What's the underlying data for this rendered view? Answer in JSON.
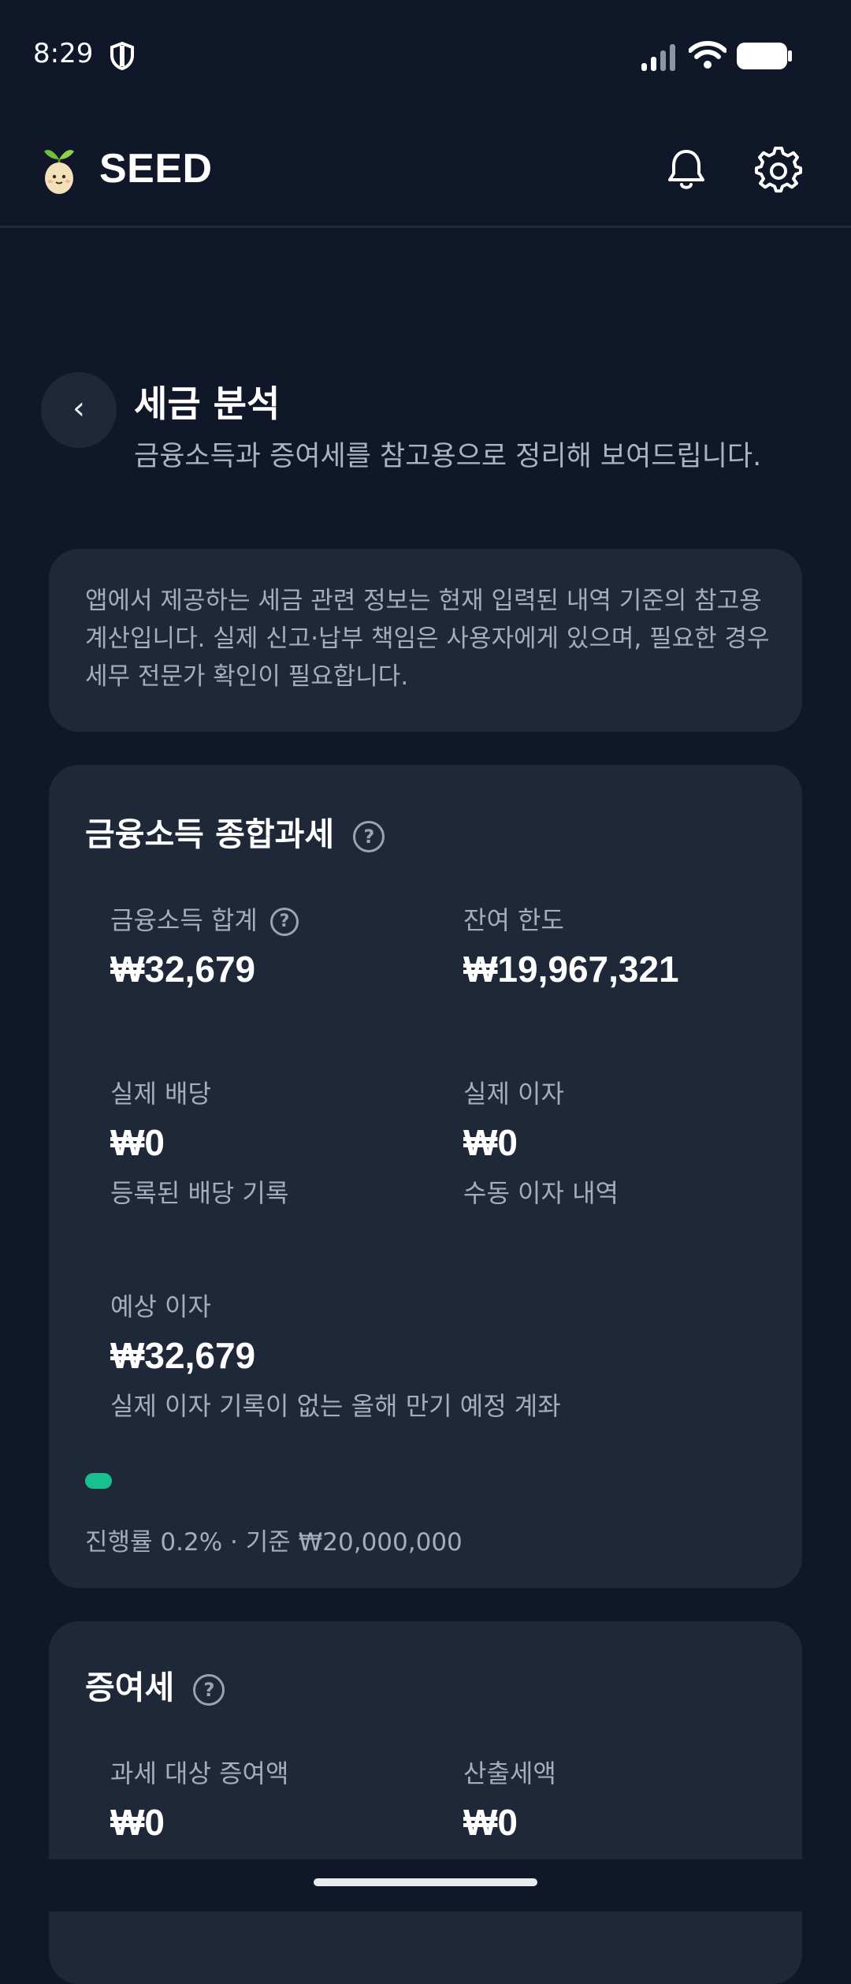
{
  "status_bar": {
    "time": "8:29"
  },
  "app_bar": {
    "brand": "SEED",
    "logo_icon": "seed-sprout-mascot",
    "notification_icon": "bell-icon",
    "settings_icon": "gear-icon"
  },
  "header": {
    "back_label": "‹",
    "title": "세금 분석",
    "subtitle": "금융소득과 증여세를 참고용으로 정리해 보여드립니다."
  },
  "notice": {
    "text": "앱에서 제공하는 세금 관련 정보는 현재 입력된 내역 기준의 참고용 계산입니다. 실제 신고·납부 책임은 사용자에게 있으며, 필요한 경우 세무 전문가 확인이 필요합니다."
  },
  "financial_income": {
    "title": "금융소득 종합과세",
    "total": {
      "label": "금융소득 합계",
      "value": "₩32,679"
    },
    "remaining": {
      "label": "잔여 한도",
      "value": "₩19,967,321"
    },
    "dividend": {
      "label": "실제 배당",
      "value": "₩0",
      "note": "등록된 배당 기록"
    },
    "interest": {
      "label": "실제 이자",
      "value": "₩0",
      "note": "수동 이자 내역"
    },
    "expected": {
      "label": "예상 이자",
      "value": "₩32,679",
      "note": "실제 이자 기록이 없는 올해 만기 예정 계좌"
    },
    "progress_percent": 0.2,
    "progress_caption": "진행률 0.2% · 기준 ₩20,000,000"
  },
  "gift_tax": {
    "title": "증여세",
    "taxable": {
      "label": "과세 대상 증여액",
      "value": "₩0"
    },
    "tax": {
      "label": "산출세액",
      "value": "₩0"
    }
  },
  "colors": {
    "background": "#0f1729",
    "card": "#1e2839",
    "accent": "#18c08f"
  }
}
